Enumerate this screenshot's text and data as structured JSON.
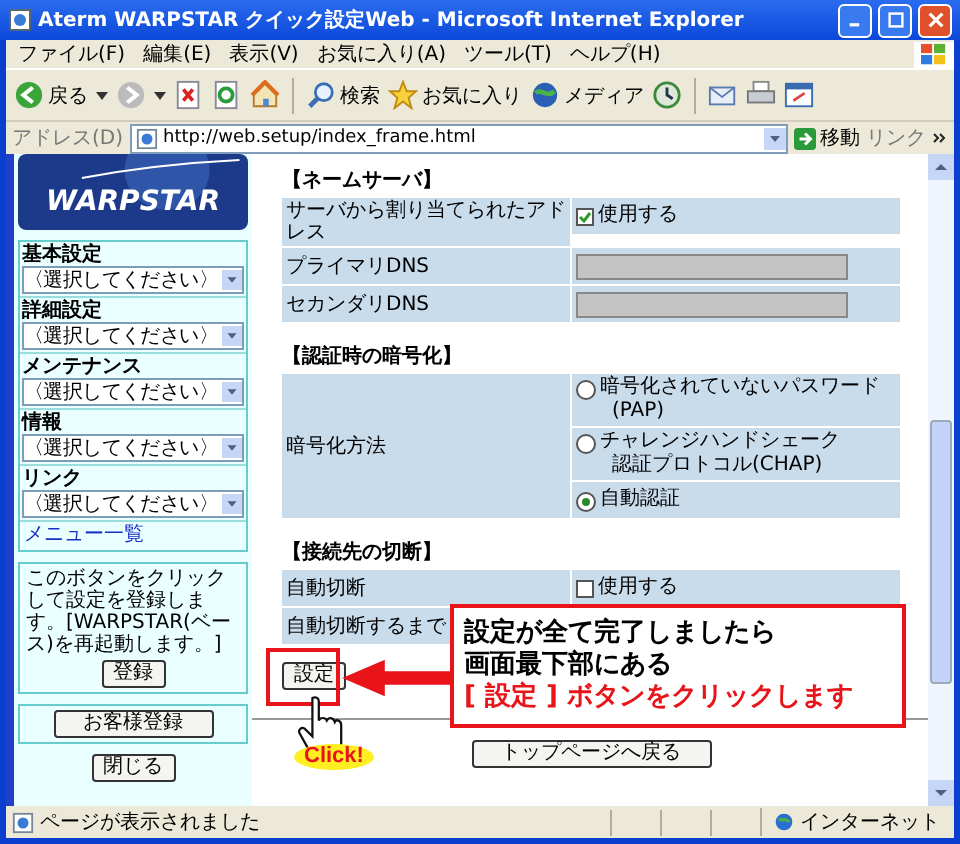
{
  "window": {
    "title": "Aterm WARPSTAR クイック設定Web - Microsoft Internet Explorer"
  },
  "menu": [
    "ファイル(F)",
    "編集(E)",
    "表示(V)",
    "お気に入り(A)",
    "ツール(T)",
    "ヘルプ(H)"
  ],
  "toolbar": [
    {
      "kind": "back",
      "label": "戻る"
    },
    {
      "kind": "forward"
    },
    {
      "kind": "stop"
    },
    {
      "kind": "refresh"
    },
    {
      "kind": "home"
    },
    {
      "kind": "search",
      "label": "検索"
    },
    {
      "kind": "favorites",
      "label": "お気に入り"
    },
    {
      "kind": "media",
      "label": "メディア"
    },
    {
      "kind": "history"
    },
    {
      "kind": "mail"
    },
    {
      "kind": "print"
    },
    {
      "kind": "edit"
    }
  ],
  "address": {
    "label": "アドレス(D)",
    "value": "http://web.setup/index_frame.html",
    "go": "移動",
    "links": "リンク"
  },
  "sidebar": {
    "logo": "WARPSTAR",
    "menus": [
      {
        "label": "基本設定",
        "value": "〈選択してください〉"
      },
      {
        "label": "詳細設定",
        "value": "〈選択してください〉"
      },
      {
        "label": "メンテナンス",
        "value": "〈選択してください〉"
      },
      {
        "label": "情報",
        "value": "〈選択してください〉"
      },
      {
        "label": "リンク",
        "value": "〈選択してください〉"
      }
    ],
    "list_link": "メニュー一覧",
    "note": "このボタンをクリックして設定を登録します。[WARPSTAR(ベース)を再起動します。]",
    "register_button": "登録",
    "customer_button": "お客様登録",
    "close_button": "閉じる"
  },
  "sections": [
    {
      "title": "【ネームサーバ】",
      "rows": [
        {
          "label": "サーバから割り当てられたアドレス",
          "options": [
            {
              "kind": "checkbox",
              "lines": [
                "使用する"
              ],
              "checked": true
            }
          ]
        },
        {
          "label": "プライマリDNS",
          "options": [
            {
              "kind": "input",
              "disabled": true
            }
          ]
        },
        {
          "label": "セカンダリDNS",
          "options": [
            {
              "kind": "input",
              "disabled": true
            }
          ]
        }
      ]
    },
    {
      "title": "【認証時の暗号化】",
      "rows": [
        {
          "label": "暗号化方法",
          "options": [
            {
              "kind": "radio",
              "lines": [
                "暗号化されていないパスワード",
                "(PAP)"
              ],
              "selected": false
            },
            {
              "kind": "radio",
              "lines": [
                "チャレンジハンドシェーク",
                "認証プロトコル(CHAP)"
              ],
              "selected": false
            },
            {
              "kind": "radio",
              "lines": [
                "自動認証"
              ],
              "selected": true
            }
          ]
        }
      ]
    },
    {
      "title": "【接続先の切断】",
      "rows": [
        {
          "label": "自動切断",
          "options": [
            {
              "kind": "checkbox",
              "lines": [
                "使用する"
              ],
              "checked": false
            }
          ]
        },
        {
          "label": "自動切断するまで",
          "options": []
        }
      ]
    }
  ],
  "set_button": "設定",
  "top_button": "トップページへ戻る",
  "callout": {
    "lines": [
      {
        "text": "設定が全て完了しましたら",
        "highlight": false
      },
      {
        "text": "画面最下部にある",
        "highlight": false
      },
      {
        "text": "[ 設定 ] ボタンをクリックします",
        "highlight": true
      }
    ],
    "click_label": "Click!"
  },
  "status_bar": {
    "text": "ページが表示されました",
    "zone": "インターネット"
  }
}
